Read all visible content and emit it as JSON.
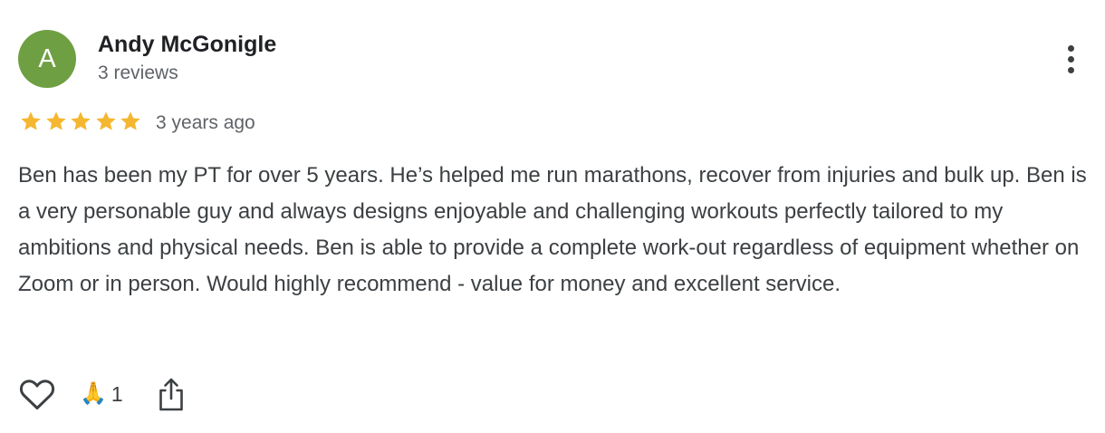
{
  "review": {
    "author": {
      "initial": "A",
      "name": "Andy McGonigle",
      "review_count": "3 reviews",
      "avatar_color": "#6f9f43"
    },
    "rating": 5,
    "max_rating": 5,
    "date": "3 years ago",
    "text": "Ben has been my PT for over 5 years. He’s helped me run marathons, recover from injuries and bulk up. Ben is a very personable guy and always designs enjoyable and challenging workouts perfectly tailored to my ambitions and physical needs. Ben is able to provide a complete work-out regardless of equipment whether on Zoom or in person. Would highly recommend - value for money and excellent service.",
    "reactions": {
      "emoji": "🙏",
      "count": "1"
    },
    "icons": {
      "menu": "more-vert-icon",
      "like": "heart-outline-icon",
      "share": "share-icon",
      "star": "star-icon"
    },
    "colors": {
      "star": "#f5b731",
      "text": "#3c4043",
      "name": "#202124",
      "secondary": "#5f6368"
    }
  }
}
